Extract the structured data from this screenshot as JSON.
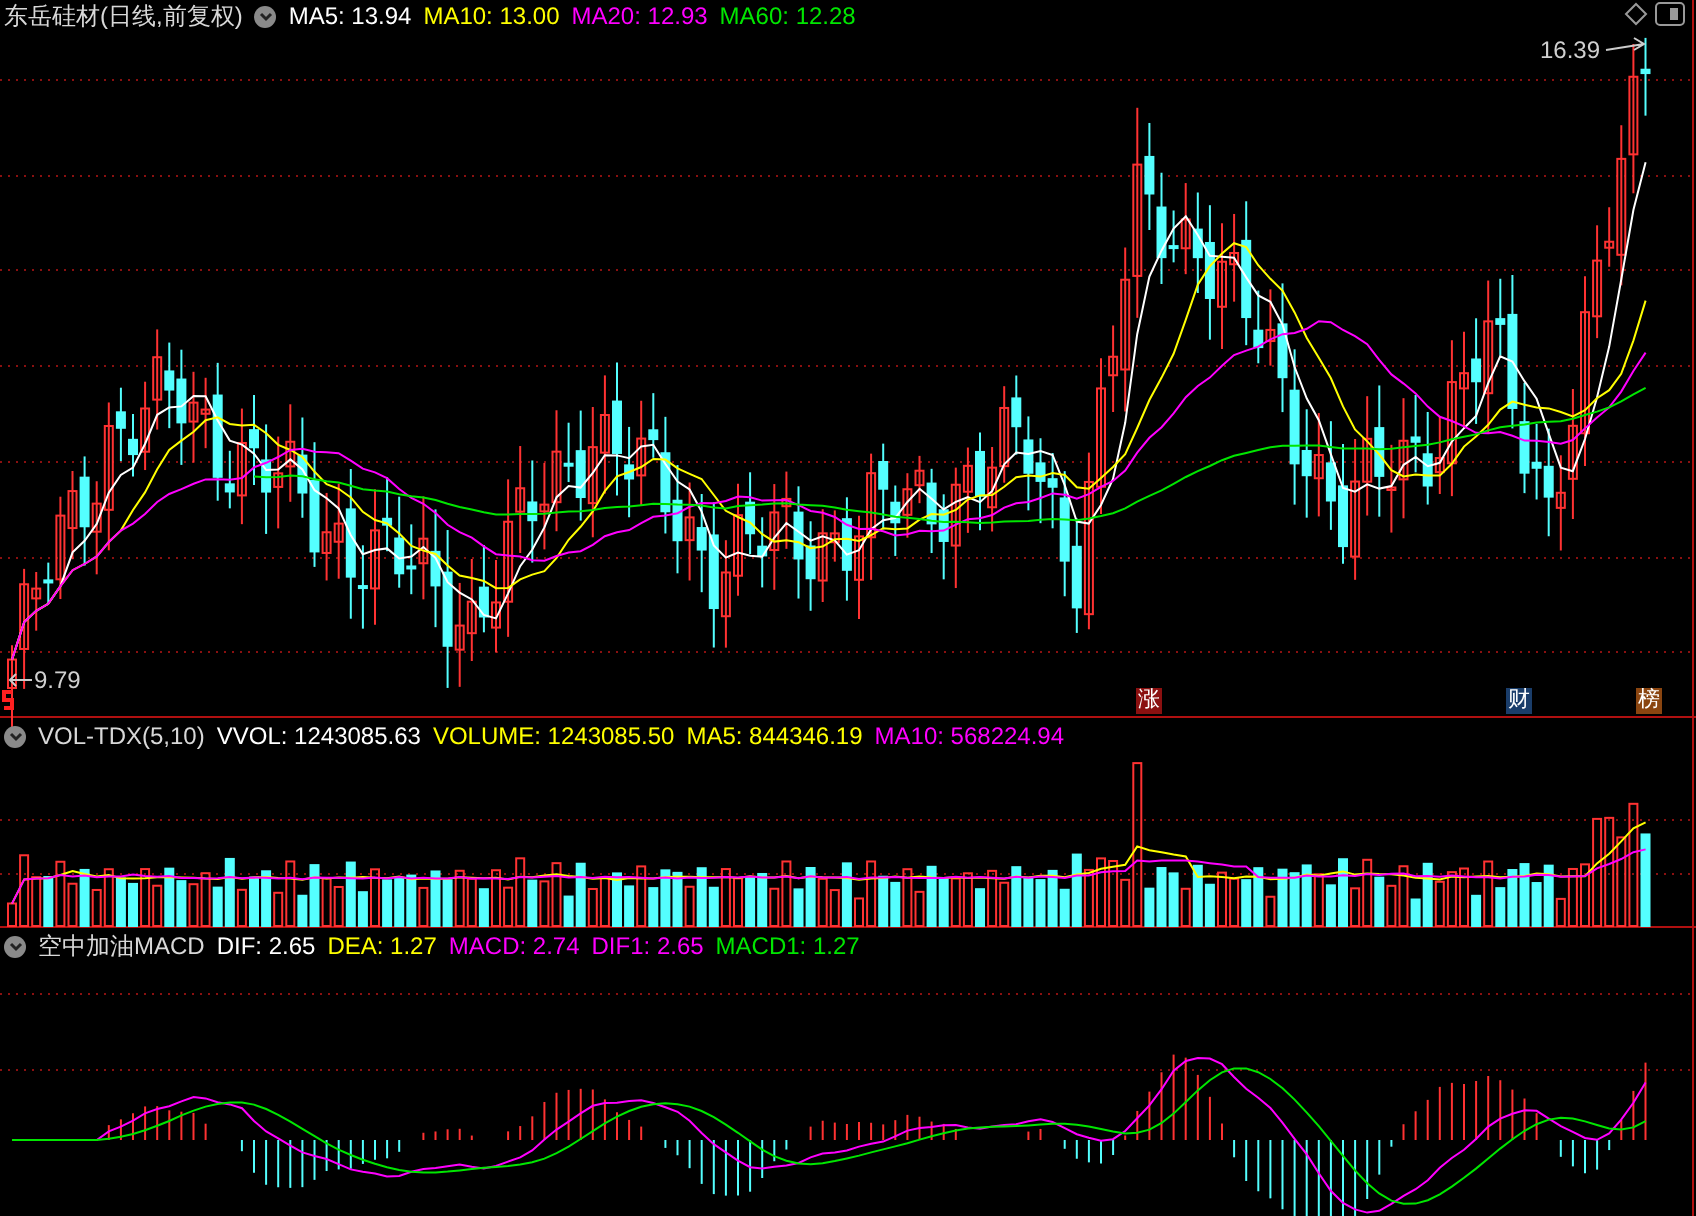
{
  "price_panel": {
    "title": "东岳硅材(日线,前复权)",
    "legend": [
      {
        "label": "MA5: 13.94",
        "color": "#ffffff"
      },
      {
        "label": "MA10: 13.00",
        "color": "#ffff00"
      },
      {
        "label": "MA20: 12.93",
        "color": "#ff00ff"
      },
      {
        "label": "MA60: 12.28",
        "color": "#00e600"
      }
    ],
    "high_label": "16.39",
    "low_label": "9.79",
    "markers": [
      {
        "label": "涨",
        "color": "#8b1010"
      },
      {
        "label": "财",
        "color": "#1a3d6a"
      },
      {
        "label": "榜",
        "color": "#8a4510"
      }
    ]
  },
  "volume_panel": {
    "title": "VOL-TDX(5,10)",
    "legend": [
      {
        "label": "VVOL: 1243085.63",
        "color": "#ffffff"
      },
      {
        "label": "VOLUME: 1243085.50",
        "color": "#ffff00"
      },
      {
        "label": "MA5: 844346.19",
        "color": "#ffff00"
      },
      {
        "label": "MA10: 568224.94",
        "color": "#ff00ff"
      }
    ]
  },
  "macd_panel": {
    "title": "空中加油MACD",
    "legend": [
      {
        "label": "DIF: 2.65",
        "color": "#ffffff"
      },
      {
        "label": "DEA: 1.27",
        "color": "#ffff00"
      },
      {
        "label": "MACD: 2.74",
        "color": "#ff00ff"
      },
      {
        "label": "DIF1: 2.65",
        "color": "#ff00ff"
      },
      {
        "label": "MACD1: 1.27",
        "color": "#00e600"
      }
    ]
  }
}
